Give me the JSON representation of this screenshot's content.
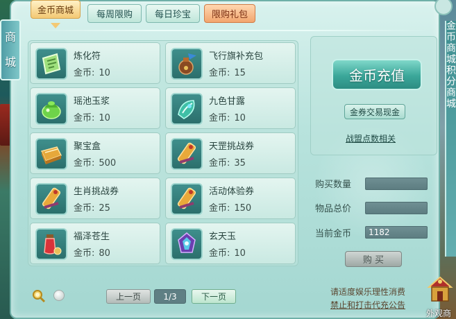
{
  "side_tab": {
    "label_1": "商",
    "label_2": "城"
  },
  "tabs": [
    {
      "label": "金币商城"
    },
    {
      "label": "每周限购"
    },
    {
      "label": "每日珍宝"
    },
    {
      "label": "限购礼包"
    }
  ],
  "items": [
    {
      "name": "炼化符",
      "currency": "金币:",
      "price": "10",
      "icon": "refining-talisman-icon"
    },
    {
      "name": "飞行旗补充包",
      "currency": "金币:",
      "price": "15",
      "icon": "flight-flag-pouch-icon"
    },
    {
      "name": "瑶池玉浆",
      "currency": "金币:",
      "price": "10",
      "icon": "jade-nectar-icon"
    },
    {
      "name": "九色甘露",
      "currency": "金币:",
      "price": "10",
      "icon": "nine-color-dew-icon"
    },
    {
      "name": "聚宝盒",
      "currency": "金币:",
      "price": "500",
      "icon": "treasure-box-icon"
    },
    {
      "name": "天罡挑战券",
      "currency": "金币:",
      "price": "35",
      "icon": "challenge-scroll-icon"
    },
    {
      "name": "生肖挑战券",
      "currency": "金币:",
      "price": "25",
      "icon": "challenge-scroll-icon"
    },
    {
      "name": "活动体验券",
      "currency": "金币:",
      "price": "150",
      "icon": "challenge-scroll-icon"
    },
    {
      "name": "福泽苍生",
      "currency": "金币:",
      "price": "80",
      "icon": "fortune-potion-icon"
    },
    {
      "name": "玄天玉",
      "currency": "金币:",
      "price": "10",
      "icon": "xuantian-jade-icon"
    }
  ],
  "recharge": {
    "label": "金币充值"
  },
  "exchange": {
    "label": "金券交易现金"
  },
  "alliance": {
    "label": "战盟点数相关"
  },
  "purchase": {
    "quantity_label": "购买数量",
    "quantity_value": "",
    "total_label": "物品总价",
    "total_value": "",
    "gold_label": "当前金币",
    "gold_value": "1182",
    "buy_label": "购 买"
  },
  "pagination": {
    "prev": "上一页",
    "indicator": "1/3",
    "next": "下一页"
  },
  "notices": {
    "line1": "请适度娱乐理性消费",
    "line2": "禁止和打击代充公告"
  },
  "right_side": {
    "chars": [
      "金",
      "币",
      "商",
      "城",
      "积",
      "分",
      "商",
      "城"
    ]
  },
  "external": {
    "label": "外观商"
  },
  "colors": {
    "panel": "#b8e3dd",
    "active_tab": "#f3c974",
    "gift_tab": "#f2a56e",
    "recharge": "#3ba79a"
  }
}
